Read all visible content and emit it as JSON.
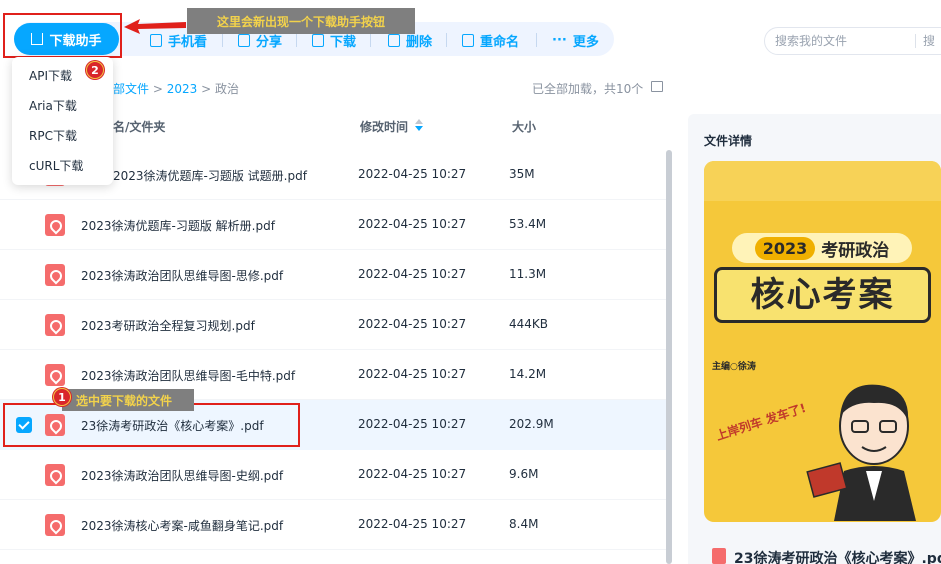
{
  "toolbar": {
    "download_label": "下载助手",
    "items": [
      "手机看",
      "分享",
      "下载",
      "删除",
      "重命名",
      "更多"
    ],
    "search_placeholder": "搜索我的文件",
    "search_extra": "搜"
  },
  "annotations": {
    "top_callout": "这里会新出现一个下载助手按钮",
    "row_callout": "选中要下载的文件",
    "num1": "1",
    "num2": "2"
  },
  "dropdown": {
    "items": [
      "API下载",
      "Aria下载",
      "RPC下载",
      "cURL下载"
    ]
  },
  "breadcrumb": {
    "part1": "部文件",
    "sep": ">",
    "part2": "2023",
    "part3": "政治",
    "status": "已全部加载，共10个"
  },
  "table": {
    "headers": {
      "name": "名/文件夹",
      "modified": "修改时间",
      "size": "大小"
    },
    "rows": [
      {
        "name": "2023徐涛优题库-习题版 试题册.pdf",
        "modified": "2022-04-25 10:27",
        "size": "35M"
      },
      {
        "name": "2023徐涛优题库-习题版 解析册.pdf",
        "modified": "2022-04-25 10:27",
        "size": "53.4M"
      },
      {
        "name": "2023徐涛政治团队思维导图-思修.pdf",
        "modified": "2022-04-25 10:27",
        "size": "11.3M"
      },
      {
        "name": "2023考研政治全程复习规划.pdf",
        "modified": "2022-04-25 10:27",
        "size": "444KB"
      },
      {
        "name": "2023徐涛政治团队思维导图-毛中特.pdf",
        "modified": "2022-04-25 10:27",
        "size": "14.2M"
      },
      {
        "name": "23徐涛考研政治《核心考案》.pdf",
        "modified": "2022-04-25 10:27",
        "size": "202.9M"
      },
      {
        "name": "2023徐涛政治团队思维导图-史纲.pdf",
        "modified": "2022-04-25 10:27",
        "size": "9.6M"
      },
      {
        "name": "2023徐涛核心考案-咸鱼翻身笔记.pdf",
        "modified": "2022-04-25 10:27",
        "size": "8.4M"
      }
    ]
  },
  "details": {
    "title": "文件详情",
    "cover_year": "2023",
    "cover_subject": "考研政治",
    "cover_title": "核心考案",
    "cover_author": "主编○徐涛",
    "cover_note": "上岸列车 发车了!",
    "file_name": "23徐涛考研政治《核心考案》.pd"
  },
  "colors": {
    "accent": "#06a7ff",
    "annotation_red": "#e0201b",
    "pdf_red": "#f56c6c",
    "cover_yellow": "#f5c83a"
  }
}
